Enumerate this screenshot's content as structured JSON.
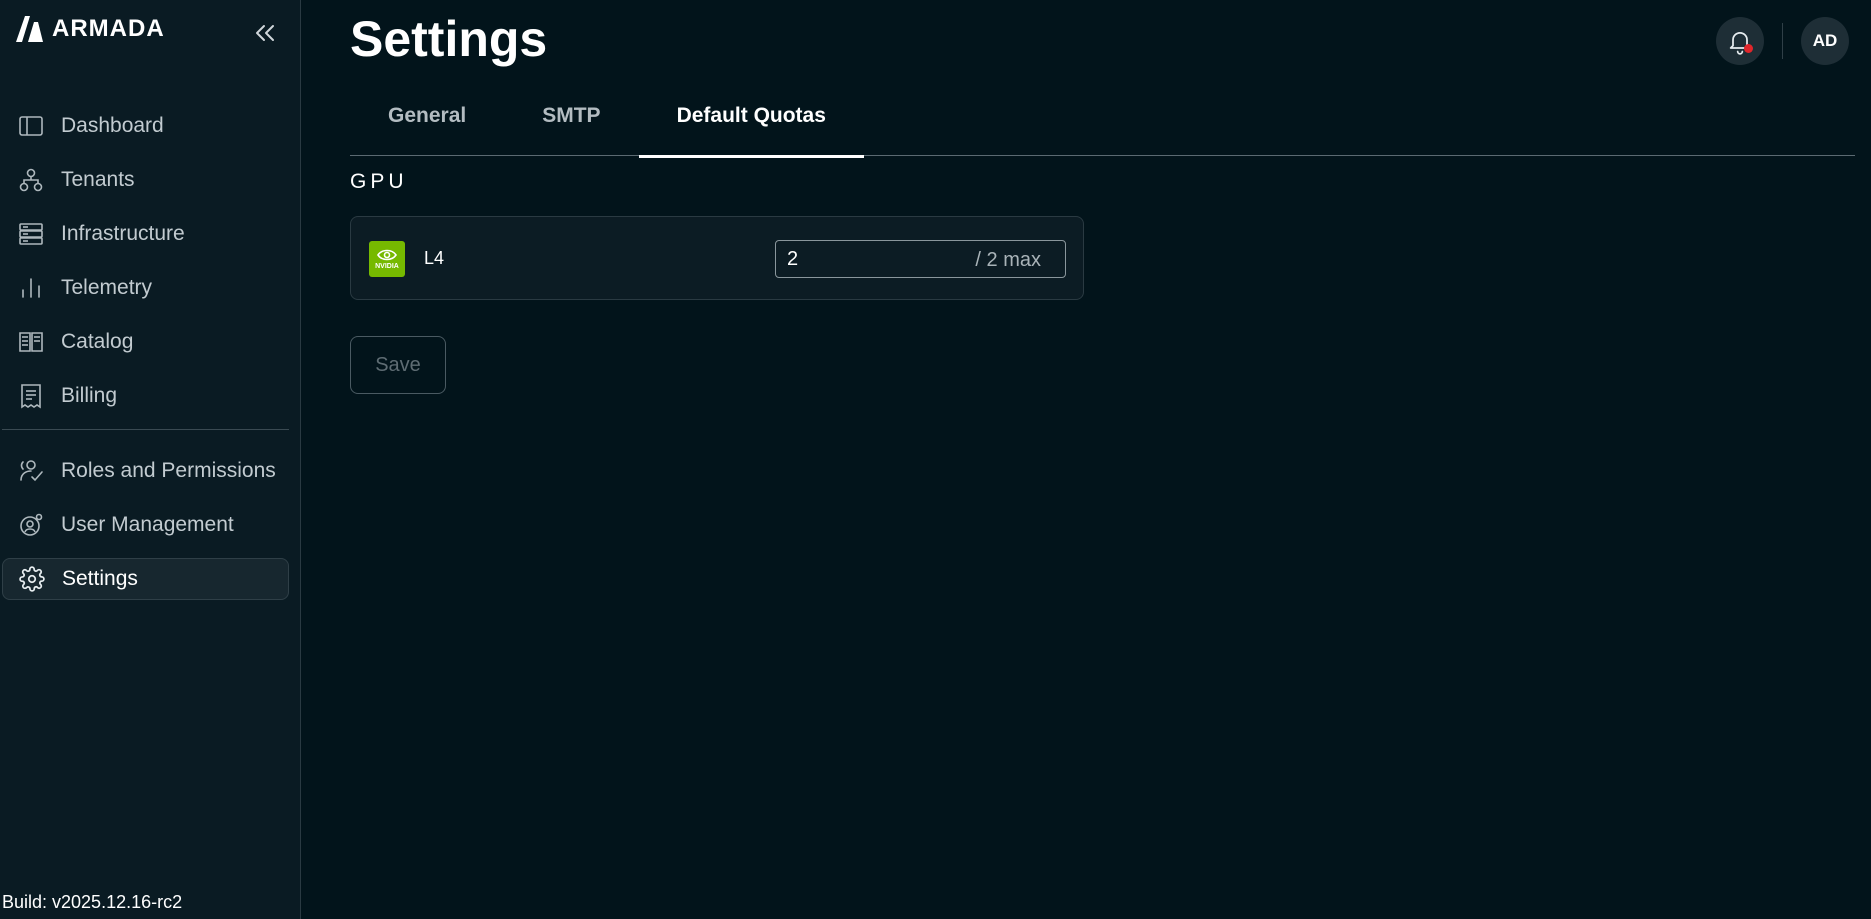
{
  "app": {
    "logo_text": "ARMADA"
  },
  "sidebar": {
    "items": [
      {
        "label": "Dashboard",
        "icon": "dashboard-icon"
      },
      {
        "label": "Tenants",
        "icon": "tenants-icon"
      },
      {
        "label": "Infrastructure",
        "icon": "infrastructure-icon"
      },
      {
        "label": "Telemetry",
        "icon": "telemetry-icon"
      },
      {
        "label": "Catalog",
        "icon": "catalog-icon"
      },
      {
        "label": "Billing",
        "icon": "billing-icon"
      }
    ],
    "items2": [
      {
        "label": "Roles and Permissions",
        "icon": "roles-icon"
      },
      {
        "label": "User Management",
        "icon": "user-management-icon"
      },
      {
        "label": "Settings",
        "icon": "gear-icon",
        "active": true
      }
    ],
    "build": "Build: v2025.12.16-rc2"
  },
  "header": {
    "title": "Settings",
    "avatar_initials": "AD",
    "notification_dot_color": "#e0262b"
  },
  "tabs": [
    {
      "label": "General"
    },
    {
      "label": "SMTP"
    },
    {
      "label": "Default Quotas",
      "active": true
    }
  ],
  "section": {
    "title": "GPU",
    "quotas": [
      {
        "name": "L4",
        "vendor_logo_text": "NVIDIA",
        "value": "2",
        "max_label": "/ 2 max"
      }
    ]
  },
  "actions": {
    "save_label": "Save"
  },
  "colors": {
    "nvidia_green": "#76b900",
    "background": "#02141b",
    "sidebar": "#0a1b23"
  }
}
